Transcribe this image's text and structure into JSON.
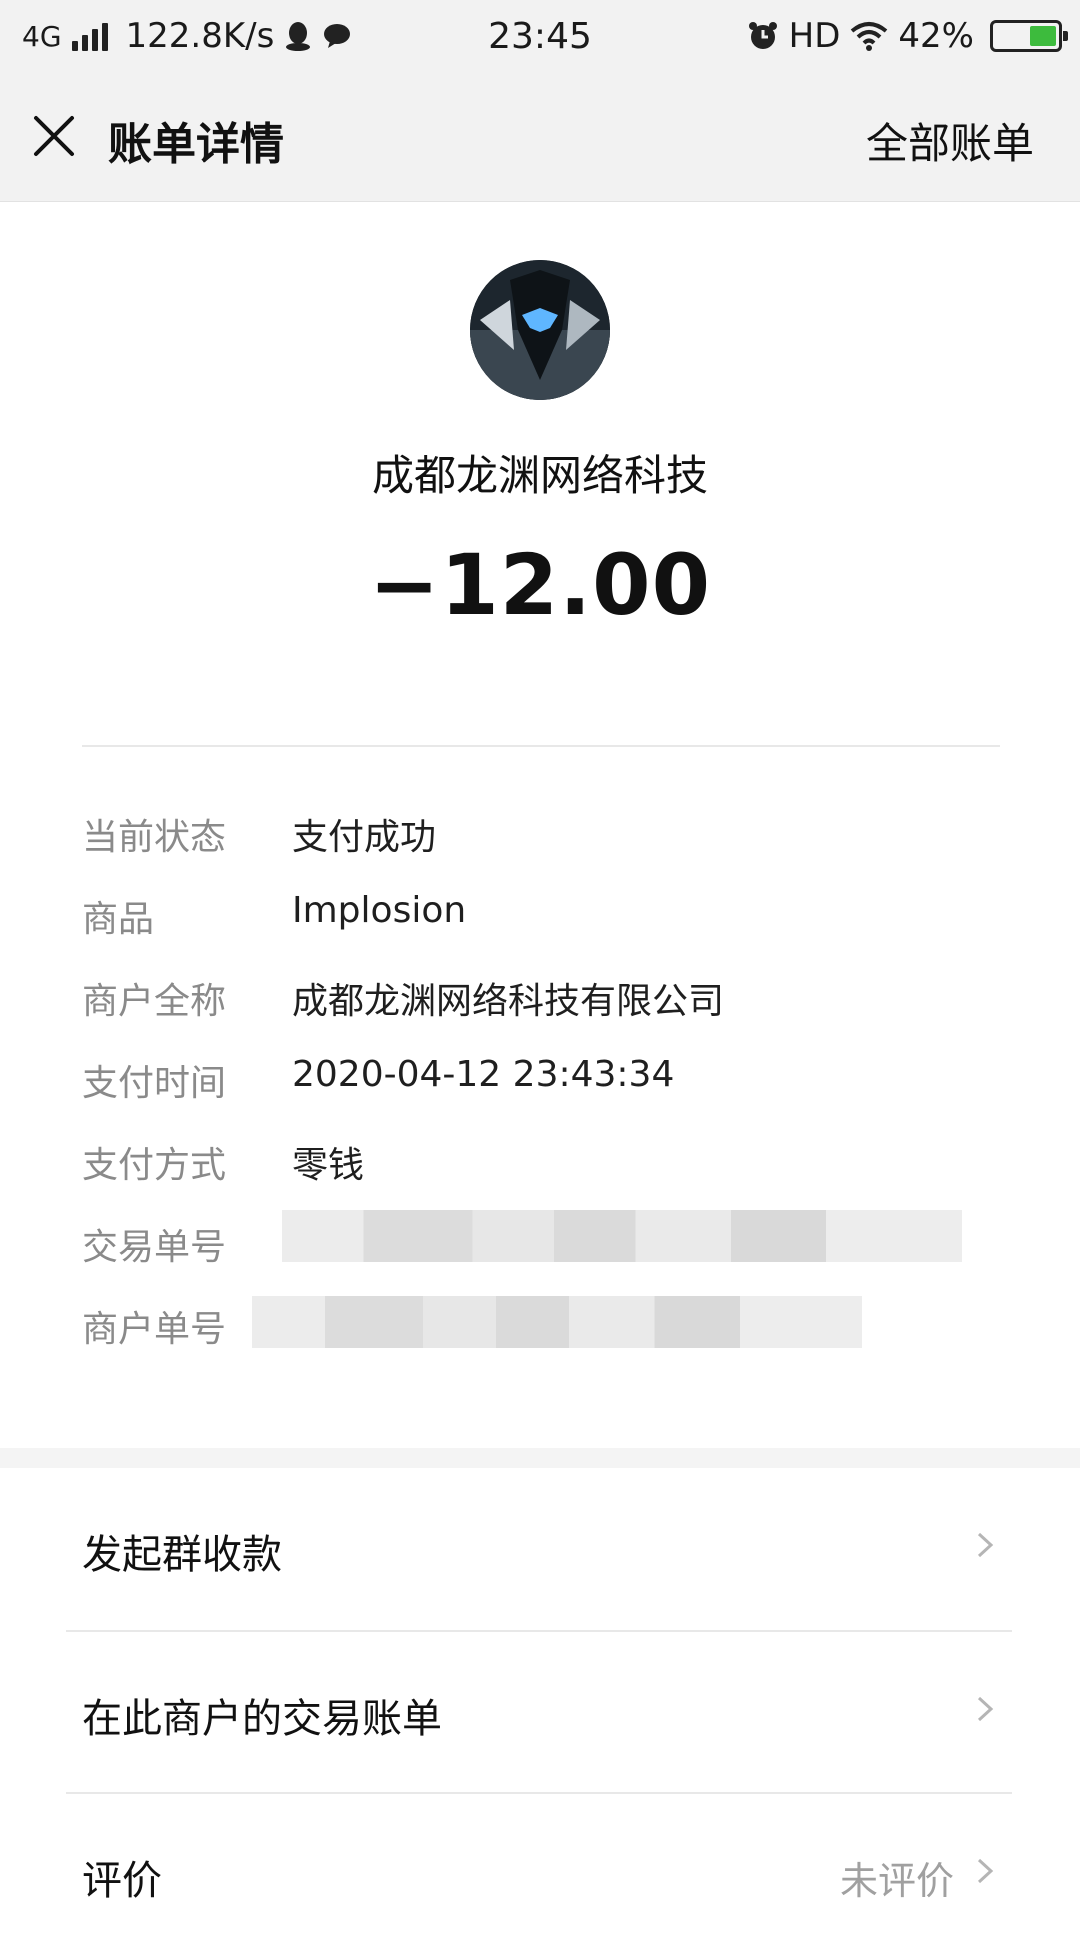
{
  "status_bar": {
    "network": "4G",
    "speed": "122.8K/s",
    "time": "23:45",
    "hd": "HD",
    "battery": "42%",
    "battery_level": 0.42
  },
  "nav": {
    "title": "账单详情",
    "right_link": "全部账单"
  },
  "header": {
    "merchant": "成都龙渊网络科技",
    "amount": "−12.00"
  },
  "details": [
    {
      "key": "当前状态",
      "value": "支付成功"
    },
    {
      "key": "商品",
      "value": "Implosion"
    },
    {
      "key": "商户全称",
      "value": "成都龙渊网络科技有限公司"
    },
    {
      "key": "支付时间",
      "value": "2020-04-12 23:43:34"
    },
    {
      "key": "支付方式",
      "value": "零钱"
    },
    {
      "key": "交易单号",
      "value": ""
    },
    {
      "key": "商户单号",
      "value": ""
    }
  ],
  "menu": [
    {
      "label": "发起群收款",
      "extra": ""
    },
    {
      "label": "在此商户的交易账单",
      "extra": ""
    },
    {
      "label": "评价",
      "extra": "未评价"
    }
  ]
}
